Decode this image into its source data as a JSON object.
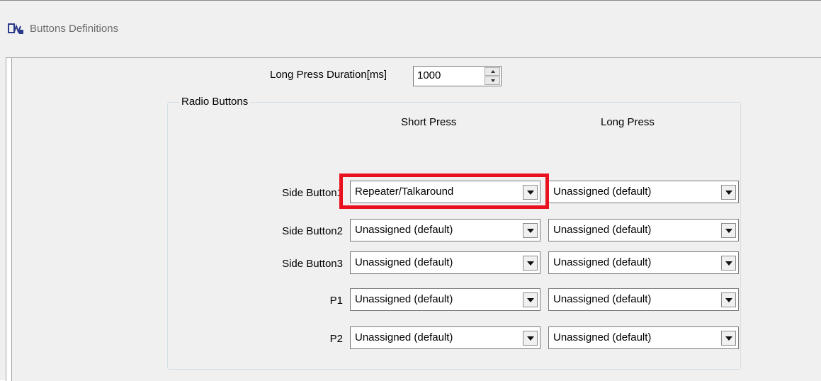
{
  "window": {
    "title": "Buttons Definitions",
    "icon": "buttons-definitions-icon"
  },
  "long_press_duration": {
    "label": "Long Press Duration[ms]",
    "value": "1000"
  },
  "radio_buttons": {
    "group_label": "Radio Buttons",
    "columns": {
      "short_press": "Short Press",
      "long_press": "Long Press"
    },
    "rows": [
      {
        "label": "Side Button1",
        "short_press": "Repeater/Talkaround",
        "long_press": "Unassigned (default)"
      },
      {
        "label": "Side Button2",
        "short_press": "Unassigned (default)",
        "long_press": "Unassigned (default)"
      },
      {
        "label": "Side Button3",
        "short_press": "Unassigned (default)",
        "long_press": "Unassigned (default)"
      },
      {
        "label": "P1",
        "short_press": "Unassigned (default)",
        "long_press": "Unassigned (default)"
      },
      {
        "label": "P2",
        "short_press": "Unassigned (default)",
        "long_press": "Unassigned (default)"
      }
    ]
  },
  "colors": {
    "highlight": "#e8111d",
    "dialog_background": "#f0f0f0"
  }
}
